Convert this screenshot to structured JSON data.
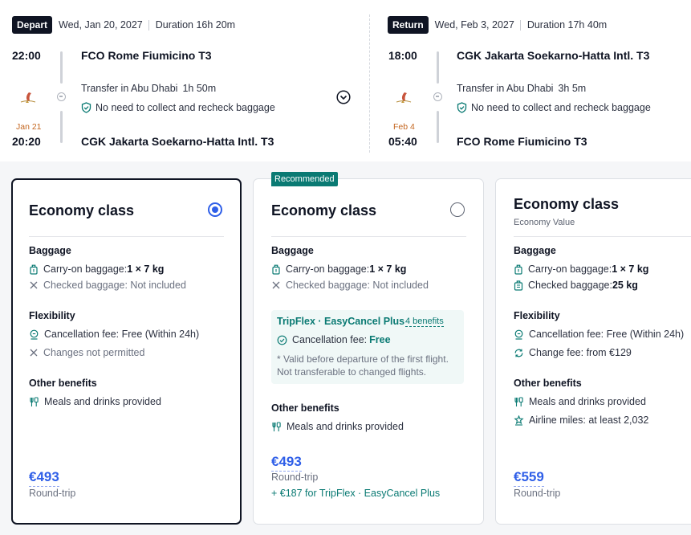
{
  "depart": {
    "badge": "Depart",
    "date": "Wed, Jan 20, 2027",
    "duration": "Duration 16h 20m",
    "dep_time": "22:00",
    "dep_airport": "FCO Rome Fiumicino T3",
    "transfer_text": "Transfer in Abu Dhabi",
    "transfer_duration": "1h 50m",
    "baggage_note": "No need to collect and recheck baggage",
    "arr_next_day": "Jan 21",
    "arr_time": "20:20",
    "arr_airport": "CGK Jakarta Soekarno-Hatta Intl. T3"
  },
  "return": {
    "badge": "Return",
    "date": "Wed, Feb 3, 2027",
    "duration": "Duration 17h 40m",
    "dep_time": "18:00",
    "dep_airport": "CGK Jakarta Soekarno-Hatta Intl. T3",
    "transfer_text": "Transfer in Abu Dhabi",
    "transfer_duration": "3h 5m",
    "baggage_note": "No need to collect and recheck baggage",
    "arr_next_day": "Feb 4",
    "arr_time": "05:40",
    "arr_airport": "FCO Rome Fiumicino T3"
  },
  "cards": [
    {
      "title": "Economy class",
      "selected": true,
      "baggage_title": "Baggage",
      "carry_on_label": "Carry-on baggage: ",
      "carry_on_value": "1 × 7 kg",
      "checked_text": "Checked baggage: Not included",
      "flex_title": "Flexibility",
      "cancel_text": "Cancellation fee: Free (Within 24h)",
      "changes_text": "Changes not permitted",
      "other_title": "Other benefits",
      "meals_text": "Meals and drinks provided",
      "price": "€493",
      "price_sub": "Round-trip"
    },
    {
      "ribbon": "Recommended",
      "title": "Economy class",
      "selected": false,
      "baggage_title": "Baggage",
      "carry_on_label": "Carry-on baggage: ",
      "carry_on_value": "1 × 7 kg",
      "checked_text": "Checked baggage: Not included",
      "tripflex_title": "TripFlex · EasyCancel Plus",
      "tripflex_link": "4 benefits",
      "tripflex_cancel_label": "Cancellation fee:",
      "tripflex_cancel_value": "Free",
      "tripflex_note": "* Valid before departure of the first flight. Not transferable to changed flights.",
      "other_title": "Other benefits",
      "meals_text": "Meals and drinks provided",
      "price": "€493",
      "price_sub": "Round-trip",
      "extra": "+ €187 for TripFlex · EasyCancel Plus"
    },
    {
      "title": "Economy class",
      "subtitle": "Economy Value",
      "baggage_title": "Baggage",
      "carry_on_label": "Carry-on baggage: ",
      "carry_on_value": "1 × 7 kg",
      "checked_label": "Checked baggage: ",
      "checked_value": "25 kg",
      "flex_title": "Flexibility",
      "cancel_text": "Cancellation fee: Free (Within 24h)",
      "change_text": "Change fee: from €129",
      "other_title": "Other benefits",
      "meals_text": "Meals and drinks provided",
      "miles_text": "Airline miles: at least 2,032",
      "price": "€559",
      "price_sub": "Round-trip"
    }
  ],
  "colors": {
    "accent_blue": "#2f5fe8",
    "teal": "#0a7a73",
    "next_day_orange": "#c4661f",
    "dark": "#0f1423"
  },
  "icons": [
    "shield-check-icon",
    "chevron-down-circle-icon",
    "carry-on-bag-icon",
    "x-icon",
    "cancel-policy-icon",
    "meals-icon",
    "checked-bag-icon",
    "change-fee-icon",
    "miles-icon",
    "check-circle-icon",
    "airline-logo-icon"
  ]
}
